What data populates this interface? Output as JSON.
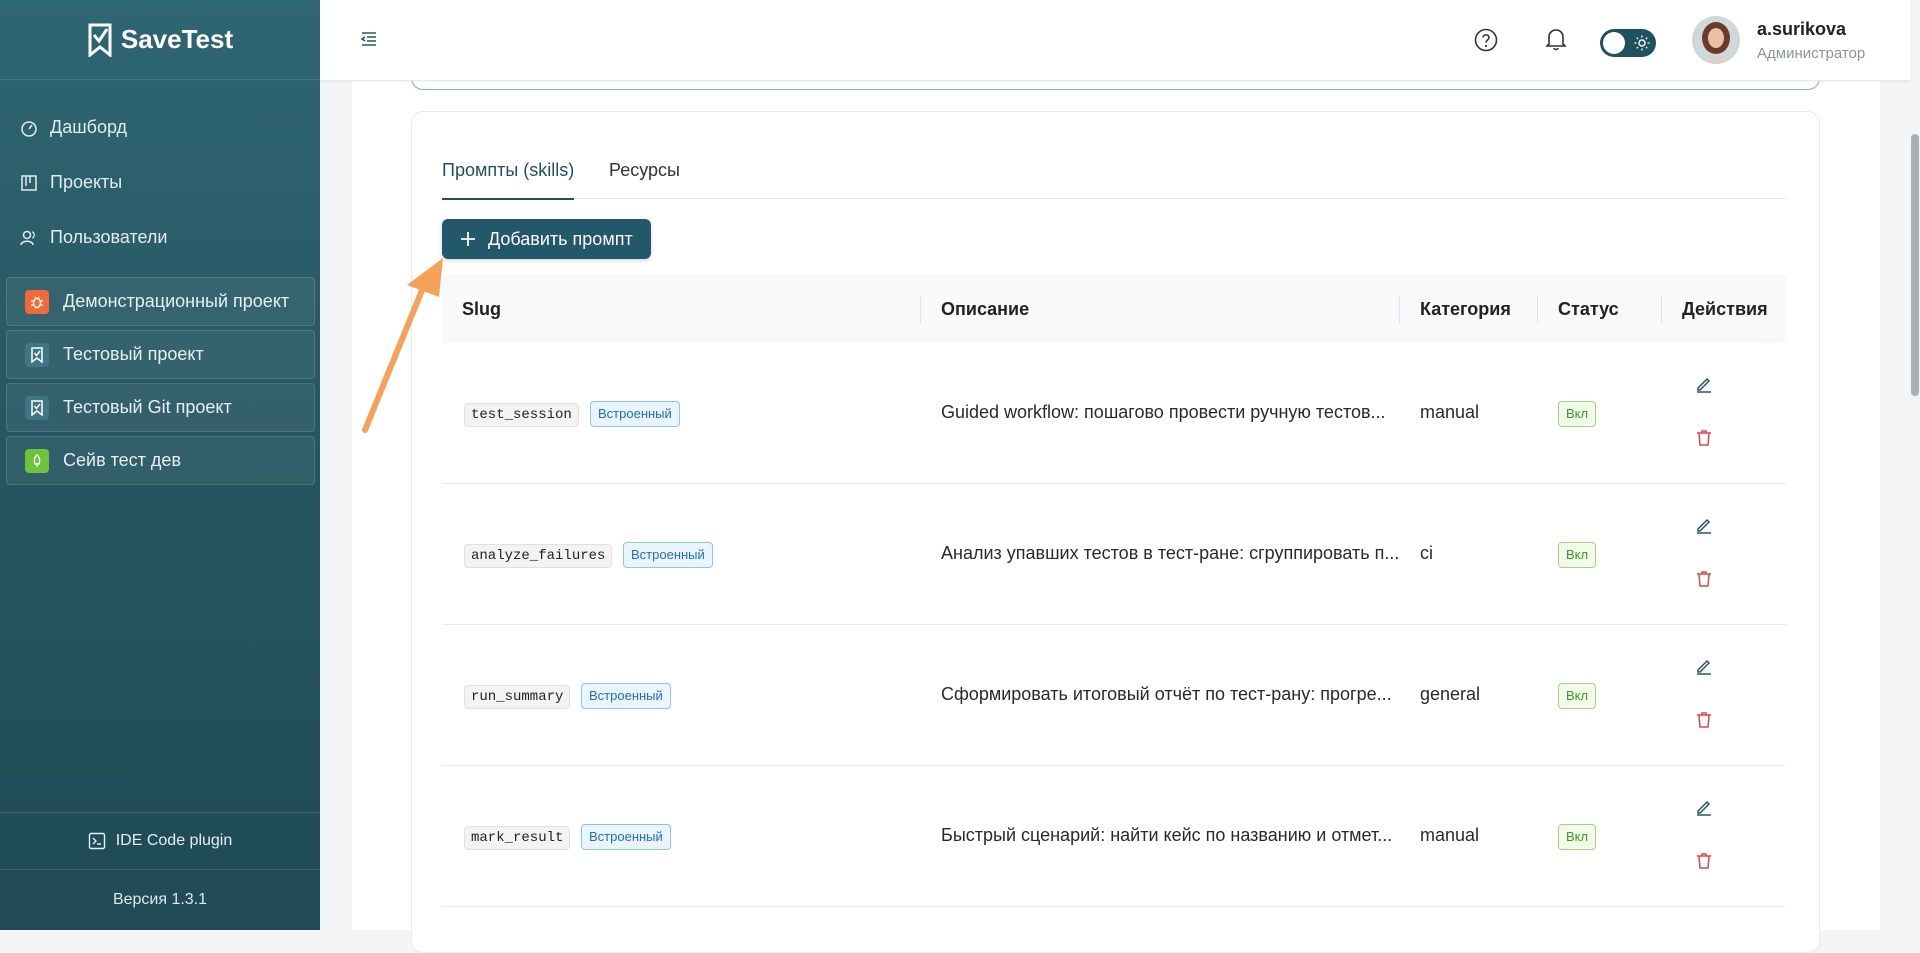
{
  "app": {
    "name": "SaveTest"
  },
  "sidebar": {
    "nav": [
      {
        "label": "Дашборд",
        "icon": "dashboard-icon"
      },
      {
        "label": "Проекты",
        "icon": "projects-icon"
      },
      {
        "label": "Пользователи",
        "icon": "users-icon"
      }
    ],
    "projects": [
      {
        "label": "Демонстрационный проект",
        "icon": "bug-icon",
        "color": "#f26a3a"
      },
      {
        "label": "Тестовый проект",
        "icon": "savetest-icon",
        "color": "#2f6673"
      },
      {
        "label": "Тестовый Git проект",
        "icon": "savetest-icon",
        "color": "#2f6673"
      },
      {
        "label": "Сейв тест дев",
        "icon": "rocket-icon",
        "color": "#6cc43a"
      }
    ],
    "ide_plugin": "IDE Code plugin",
    "version": "Версия 1.3.1"
  },
  "header": {
    "user": {
      "name": "a.surikova",
      "role": "Администратор"
    },
    "theme_toggle": "light"
  },
  "tabs": [
    {
      "label": "Промпты (skills)",
      "active": true
    },
    {
      "label": "Ресурсы",
      "active": false
    }
  ],
  "add_button": "Добавить промпт",
  "table": {
    "columns": [
      "Slug",
      "Описание",
      "Категория",
      "Статус",
      "Действия"
    ],
    "rows": [
      {
        "slug": "test_session",
        "badge": "Встроенный",
        "description": "Guided workflow: пошагово провести ручную тестов...",
        "category": "manual",
        "status": "Вкл"
      },
      {
        "slug": "analyze_failures",
        "badge": "Встроенный",
        "description": "Анализ упавших тестов в тест-ране: сгруппировать п...",
        "category": "ci",
        "status": "Вкл"
      },
      {
        "slug": "run_summary",
        "badge": "Встроенный",
        "description": "Сформировать итоговый отчёт по тест-рану: прогре...",
        "category": "general",
        "status": "Вкл"
      },
      {
        "slug": "mark_result",
        "badge": "Встроенный",
        "description": "Быстрый сценарий: найти кейс по названию и отмет...",
        "category": "manual",
        "status": "Вкл"
      }
    ]
  },
  "colors": {
    "primary": "#23586a",
    "sidebar": "#2a5e6b",
    "danger": "#e0474c",
    "success": "#3a9a23",
    "info": "#1f6fc2"
  }
}
